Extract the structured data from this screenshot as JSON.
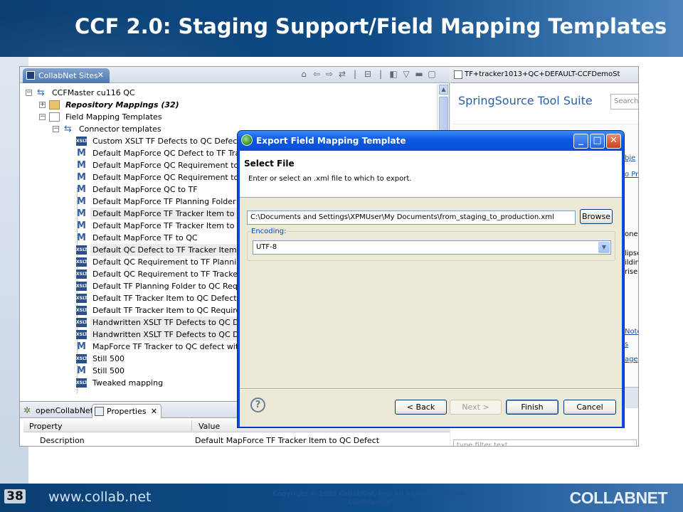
{
  "slide": {
    "title": "CCF 2.0: Staging Support/Field Mapping Templates",
    "number": "38",
    "footer_url": "www.collab.net",
    "footer_copyright_1": "Copyright © 2008 CollabNet, Inc. All Rights Reserved.",
    "footer_copyright_2": "Confidential",
    "logo": "COLLABNET"
  },
  "sites_view": {
    "tab_label": "CollabNet Sites",
    "tab_close": "✕",
    "tree": [
      {
        "label": "CCFMaster cu116 QC",
        "icon": "arrows",
        "indent": 0,
        "expander": "−",
        "bold": false
      },
      {
        "label": "Repository Mappings (32)",
        "icon": "folder",
        "indent": 1,
        "expander": "+",
        "bold": true
      },
      {
        "label": "Field Mapping Templates",
        "icon": "doc",
        "indent": 1,
        "expander": "−",
        "bold": false
      },
      {
        "label": "Connector templates",
        "icon": "arrows",
        "indent": 2,
        "expander": "−",
        "bold": false
      },
      {
        "label": "Custom XSLT TF Defects to QC Defect Te",
        "icon": "xslt",
        "indent": 3
      },
      {
        "label": "Default MapForce QC Defect to TF Tracke",
        "icon": "m",
        "indent": 3
      },
      {
        "label": "Default MapForce QC Requirement to TF",
        "icon": "m",
        "indent": 3
      },
      {
        "label": "Default MapForce QC Requirement to TF",
        "icon": "m",
        "indent": 3
      },
      {
        "label": "Default MapForce QC to TF",
        "icon": "m",
        "indent": 3
      },
      {
        "label": "Default MapForce TF Planning Folder to Q",
        "icon": "m",
        "indent": 3
      },
      {
        "label": "Default MapForce TF Tracker Item to QC",
        "icon": "m",
        "indent": 3,
        "selected": true
      },
      {
        "label": "Default MapForce TF Tracker Item to QC",
        "icon": "m",
        "indent": 3
      },
      {
        "label": "Default MapForce TF to QC",
        "icon": "m",
        "indent": 3
      },
      {
        "label": "Default QC Defect to TF Tracker Item",
        "icon": "xslt",
        "indent": 3,
        "selected": true
      },
      {
        "label": "Default QC Requirement to TF Planning F",
        "icon": "xslt",
        "indent": 3
      },
      {
        "label": "Default QC Requirement to TF Tracker Ite",
        "icon": "xslt",
        "indent": 3
      },
      {
        "label": "Default TF Planning Folder to QC Require",
        "icon": "xslt",
        "indent": 3
      },
      {
        "label": "Default TF Tracker Item to QC Defect",
        "icon": "xslt",
        "indent": 3
      },
      {
        "label": "Default TF Tracker Item to QC Requireme",
        "icon": "xslt",
        "indent": 3
      },
      {
        "label": "Handwritten XSLT TF Defects to QC Defe",
        "icon": "xslt",
        "indent": 3,
        "selected": true
      },
      {
        "label": "Handwritten XSLT TF Defects to QC Defe",
        "icon": "xslt",
        "indent": 3,
        "selected": true
      },
      {
        "label": "MapForce TF Tracker to QC defect withou",
        "icon": "m",
        "indent": 3
      },
      {
        "label": "Still 500",
        "icon": "xslt",
        "indent": 3
      },
      {
        "label": "Still 500",
        "icon": "m",
        "indent": 3
      },
      {
        "label": "Tweaked mapping",
        "icon": "xslt",
        "indent": 3
      }
    ]
  },
  "properties_view": {
    "tab_opencollabnet": "openCollabNet",
    "tab_properties": "Properties",
    "col_property": "Property",
    "col_value": "Value",
    "row_property": "Description",
    "row_value": "Default MapForce TF Tracker Item to QC Defect"
  },
  "right_panel": {
    "tab_label": "TF+tracker1013+QC+DEFAULT-CCFDemoSt",
    "title": "SpringSource Tool Suite",
    "search_placeholder": "Search",
    "fragments": [
      "bje",
      "o Pr",
      "one",
      "lipse",
      "ildin",
      "rise",
      "Note",
      "s",
      "age"
    ],
    "filter_placeholder": "type filter text"
  },
  "dialog": {
    "title": "Export Field Mapping Template",
    "heading": "Select File",
    "description": "Enter or select an .xml file to which to export.",
    "path_value": "C:\\Documents and Settings\\XPMUser\\My Documents\\from_staging_to_production.xml",
    "browse_label": "Browse",
    "encoding_label": "Encoding:",
    "encoding_value": "UTF-8",
    "help_glyph": "?",
    "back_label": "< Back",
    "next_label": "Next >",
    "finish_label": "Finish",
    "cancel_label": "Cancel",
    "min_glyph": "_",
    "max_glyph": "□",
    "close_glyph": "✕"
  }
}
